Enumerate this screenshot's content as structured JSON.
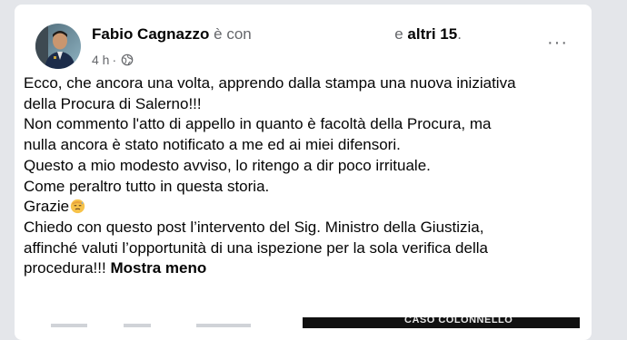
{
  "post": {
    "author": "Fabio Cagnazzo",
    "with_text": "è con",
    "and_text": "e",
    "others": "altri 15",
    "period": ".",
    "time": "4 h",
    "separator": "·",
    "privacy_icon": "globe-icon",
    "more_icon": "more-options-icon",
    "more_label": "···",
    "lines": [
      "Ecco, che ancora una volta, apprendo dalla stampa una nuova iniziativa",
      "della Procura di Salerno!!!",
      "Non commento l'atto di appello in quanto è facoltà della Procura, ma",
      "nulla ancora è stato notificato a me ed ai miei difensori.",
      "Questo a mio modesto avviso, lo ritengo a dir poco irrituale.",
      "Come peraltro tutto in questa storia.",
      "Grazie",
      "Chiedo con questo post l’intervento del Sig. Ministro della Giustizia,",
      "affinché valuti l’opportunità di una ispezione per la sola verifica della",
      "procedura!!!"
    ],
    "show_less": "Mostra meno",
    "emoji_icon": "hot-face-emoji-icon"
  },
  "attachment": {
    "right_caption": "CASO COLONNELLO"
  },
  "colors": {
    "background": "#e4e6ea",
    "card": "#ffffff",
    "muted": "#65676b"
  }
}
